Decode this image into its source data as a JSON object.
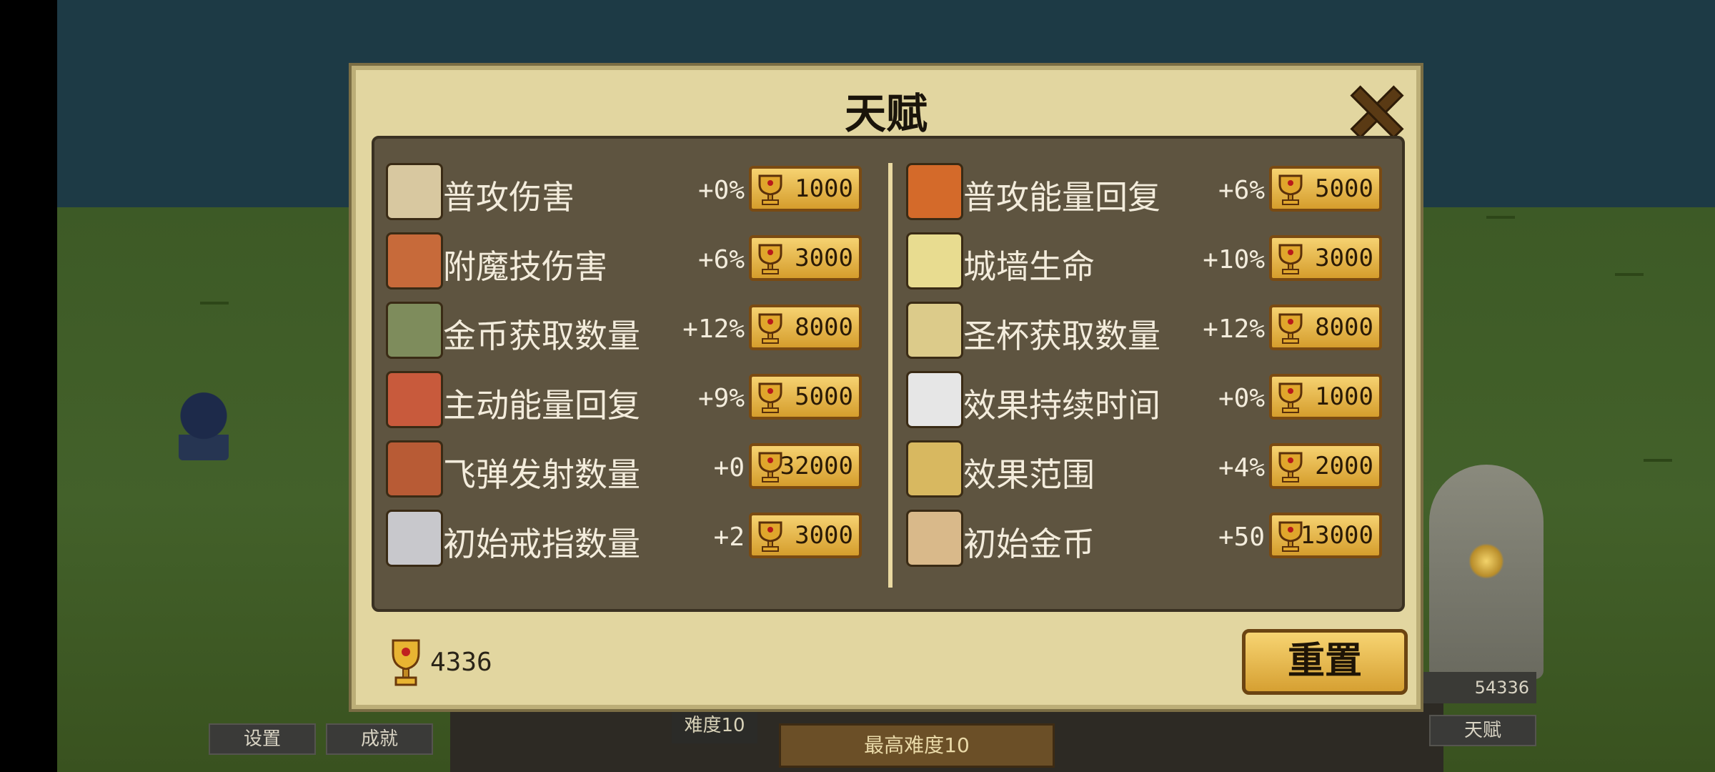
{
  "background": {
    "menu": {
      "settings": "设置",
      "achievements": "成就",
      "talent": "天赋"
    },
    "badge_trophies": "54336",
    "difficulty_small": "难度10",
    "difficulty_max": "最高难度10"
  },
  "dialog": {
    "title": "天赋",
    "left": [
      {
        "name": "普攻伤害",
        "value": "+0%",
        "cost": "1000",
        "icon": "scroll-icon",
        "color": "#d8c8a0"
      },
      {
        "name": "附魔技伤害",
        "value": "+6%",
        "cost": "3000",
        "icon": "scroll-red-icon",
        "color": "#c76a3a"
      },
      {
        "name": "金币获取数量",
        "value": "+12%",
        "cost": "8000",
        "icon": "map-scroll-icon",
        "color": "#7e8c5c"
      },
      {
        "name": "主动能量回复",
        "value": "+9%",
        "cost": "5000",
        "icon": "fish-scroll-icon",
        "color": "#c85a3c"
      },
      {
        "name": "飞弹发射数量",
        "value": "+0",
        "cost": "32000",
        "icon": "curled-scroll-icon",
        "color": "#b85b35"
      },
      {
        "name": "初始戒指数量",
        "value": "+2",
        "cost": "3000",
        "icon": "ring-scroll-icon",
        "color": "#c8c8cc"
      }
    ],
    "right": [
      {
        "name": "普攻能量回复",
        "value": "+6%",
        "cost": "5000",
        "icon": "orange-book-icon",
        "color": "#d46a2a"
      },
      {
        "name": "城墙生命",
        "value": "+10%",
        "cost": "3000",
        "icon": "yellow-scroll-icon",
        "color": "#e8dc90"
      },
      {
        "name": "圣杯获取数量",
        "value": "+12%",
        "cost": "8000",
        "icon": "parchment-icon",
        "color": "#dccb8a"
      },
      {
        "name": "效果持续时间",
        "value": "+0%",
        "cost": "1000",
        "icon": "white-scroll-icon",
        "color": "#e6e6e6"
      },
      {
        "name": "效果范围",
        "value": "+4%",
        "cost": "2000",
        "icon": "purple-seal-scroll-icon",
        "color": "#d8b860"
      },
      {
        "name": "初始金币",
        "value": "+50",
        "cost": "13000",
        "icon": "swirl-scroll-icon",
        "color": "#d9b98a"
      }
    ],
    "trophies": "4336",
    "reset_label": "重置"
  }
}
